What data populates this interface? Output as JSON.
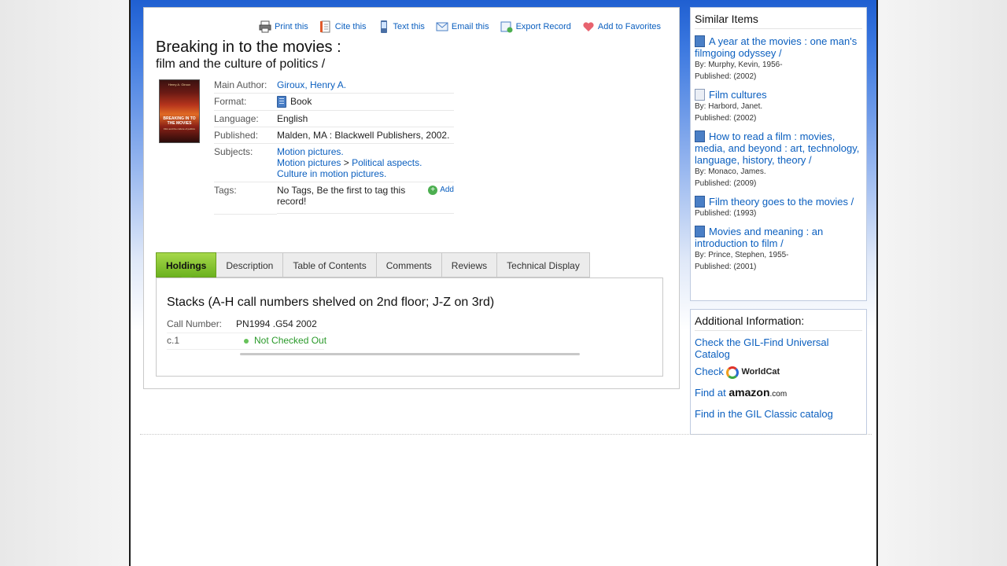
{
  "toolbar": {
    "print": "Print this",
    "cite": "Cite this",
    "text": "Text this",
    "email": "Email this",
    "export": "Export Record",
    "favorites": "Add to Favorites"
  },
  "record": {
    "title": "Breaking in to the movies :",
    "subtitle": "film and the culture of politics /",
    "cover": {
      "author": "Henry A. Giroux",
      "title": "BREAKING IN TO THE MOVIES",
      "subtitle": "Film and the culture of politics"
    },
    "labels": {
      "author": "Main Author:",
      "format": "Format:",
      "language": "Language:",
      "published": "Published:",
      "subjects": "Subjects:",
      "tags": "Tags:"
    },
    "author": "Giroux, Henry A.",
    "format": "Book",
    "language": "English",
    "published": "Malden, MA : Blackwell Publishers, 2002.",
    "subjects": {
      "s1": "Motion pictures.",
      "s2a": "Motion pictures",
      "sep": ">",
      "s2b": "Political aspects.",
      "s3": "Culture in motion pictures."
    },
    "tags": "No Tags, Be the first to tag this record!",
    "add_tag": "Add"
  },
  "tabs": [
    "Holdings",
    "Description",
    "Table of Contents",
    "Comments",
    "Reviews",
    "Technical Display"
  ],
  "holdings": {
    "location": "Stacks (A-H call numbers shelved on 2nd floor; J-Z on 3rd)",
    "call_label": "Call Number:",
    "call_number": "PN1994 .G54 2002",
    "copy": "c.1",
    "status": "Not Checked Out"
  },
  "similar": {
    "title": "Similar Items",
    "items": [
      {
        "title": "A year at the movies : one man's filmgoing odyssey /",
        "by": "By: Murphy, Kevin, 1956-",
        "published": "Published: (2002)"
      },
      {
        "title": "Film cultures",
        "by": "By: Harbord, Janet.",
        "published": "Published: (2002)"
      },
      {
        "title": "How to read a film : movies, media, and beyond : art, technology, language, history, theory /",
        "by": "By: Monaco, James.",
        "published": "Published: (2009)"
      },
      {
        "title": "Film theory goes to the movies /",
        "published": "Published: (1993)"
      },
      {
        "title": "Movies and meaning : an introduction to film /",
        "by": "By: Prince, Stephen, 1955-",
        "published": "Published: (2001)"
      }
    ]
  },
  "additional": {
    "title": "Additional Information:",
    "gil_find": "Check the GIL-Find Universal Catalog",
    "check": "Check",
    "worldcat": "WorldCat",
    "find_at": "Find at",
    "amazon": "amazon",
    "amazon_suffix": ".com",
    "gil_classic": "Find in the GIL Classic catalog"
  },
  "colors": {
    "link": "#0b5fbf",
    "active_tab": "#6bb21f",
    "status_green": "#2a9a2a",
    "header_blue": "#1f5fd1"
  }
}
